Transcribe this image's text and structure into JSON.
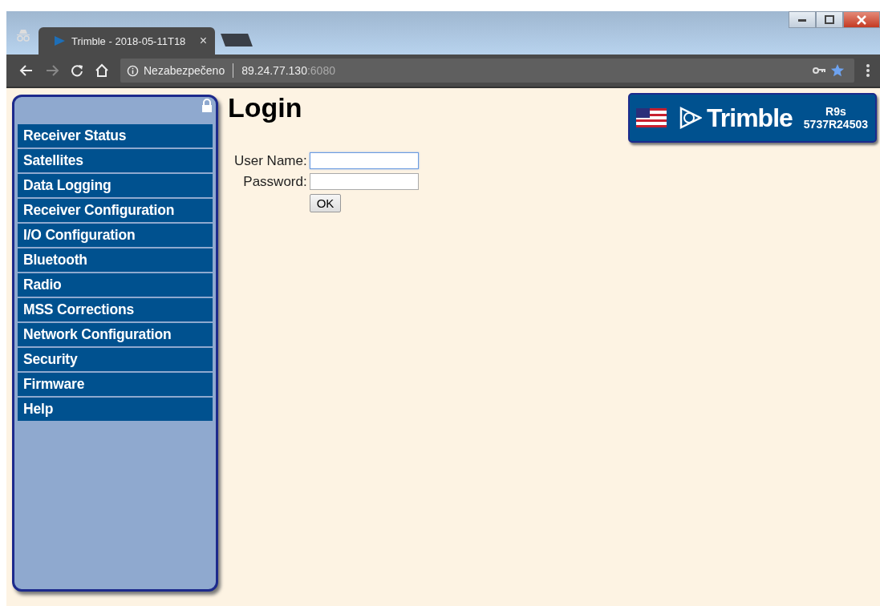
{
  "browser": {
    "tab_title": "Trimble - 2018-05-11T18",
    "tab_close": "×",
    "security_label": "Nezabezpečeno",
    "url_host": "89.24.77.130",
    "url_port": ":6080"
  },
  "sidebar": {
    "items": [
      {
        "label": "Receiver Status"
      },
      {
        "label": "Satellites"
      },
      {
        "label": "Data Logging"
      },
      {
        "label": "Receiver Configuration"
      },
      {
        "label": "I/O Configuration"
      },
      {
        "label": "Bluetooth"
      },
      {
        "label": "Radio"
      },
      {
        "label": "MSS Corrections"
      },
      {
        "label": "Network Configuration"
      },
      {
        "label": "Security"
      },
      {
        "label": "Firmware"
      },
      {
        "label": "Help"
      }
    ]
  },
  "page": {
    "title": "Login",
    "fields": [
      {
        "label": "User Name:",
        "focused": true
      },
      {
        "label": "Password:",
        "focused": false
      }
    ],
    "submit": "OK"
  },
  "badge": {
    "brand": "Trimble",
    "model": "R9s",
    "serial": "5737R24503"
  }
}
